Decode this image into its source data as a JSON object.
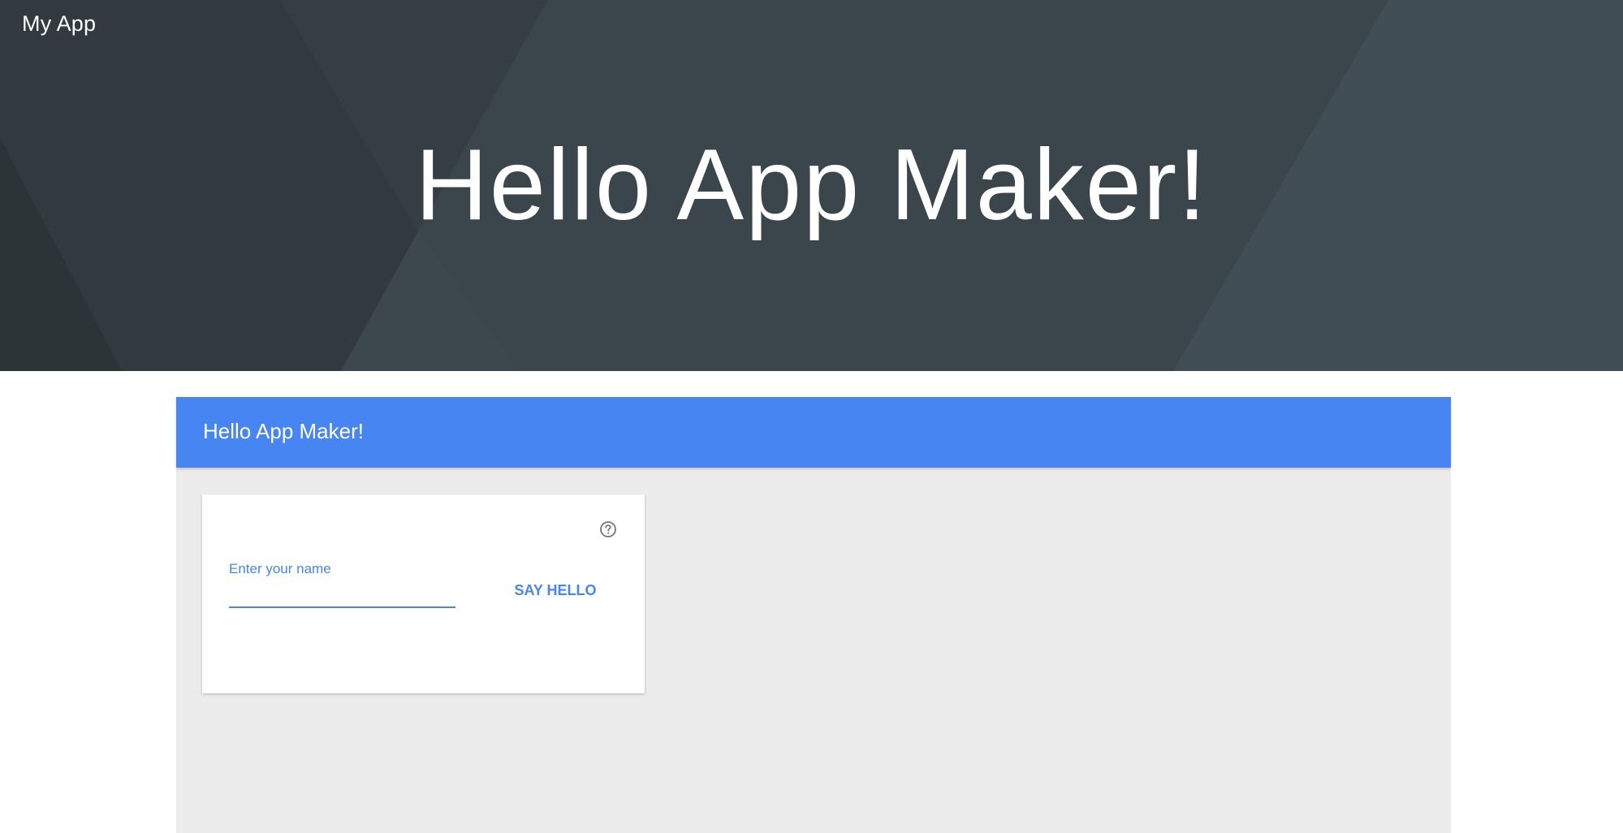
{
  "header": {
    "app_title": "My App",
    "hero_heading": "Hello App Maker!"
  },
  "panel": {
    "title": "Hello App Maker!",
    "card": {
      "help_icon": "help-circle-icon",
      "name_field": {
        "label": "Enter your name",
        "value": ""
      },
      "say_hello_label": "SAY HELLO"
    }
  },
  "colors": {
    "accent": "#4685f2",
    "hero_background": "#3a444b",
    "panel_background": "#ececec"
  }
}
